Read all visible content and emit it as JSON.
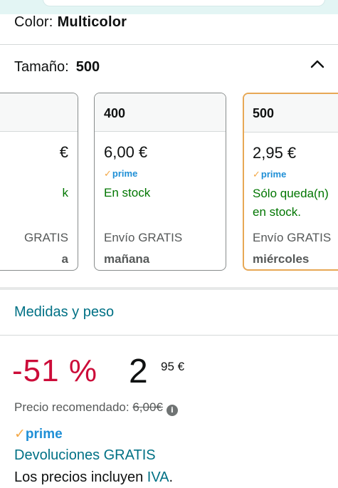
{
  "header": {
    "color_label": "Color:",
    "color_value": "Multicolor",
    "size_label": "Tamaño:",
    "size_value": "500"
  },
  "size_cards": [
    {
      "size": "",
      "price": "€",
      "prime": false,
      "stock": "k",
      "shipping": "GRATIS",
      "delivery": "a",
      "selected": false
    },
    {
      "size": "400",
      "price": "6,00 €",
      "prime": true,
      "stock": "En stock",
      "shipping": "Envío GRATIS",
      "delivery": "mañana",
      "selected": false
    },
    {
      "size": "500",
      "price": "2,95 €",
      "prime": true,
      "stock": "Sólo queda(n) en stock.",
      "stock_line1": "Sólo queda(n)",
      "stock_line2": "en stock.",
      "shipping": "Envío GRATIS",
      "delivery": "miércoles",
      "selected": true
    }
  ],
  "prime_label": "prime",
  "medidas_link": "Medidas y peso",
  "pricing": {
    "discount": "-51 %",
    "price_whole": "2",
    "price_fraction": "95",
    "currency": "€",
    "recommended_label": "Precio recomendado:",
    "recommended_value": "6,00€",
    "returns": "Devoluciones GRATIS",
    "tax_note_prefix": "Los precios incluyen ",
    "tax_note_link": "IVA",
    "tax_note_suffix": "."
  },
  "colors": {
    "accent_teal": "#007185",
    "discount_red": "#cc0c39",
    "stock_green": "#007600",
    "prime_blue": "#1f8fd6",
    "selected_border": "#e7a855"
  }
}
